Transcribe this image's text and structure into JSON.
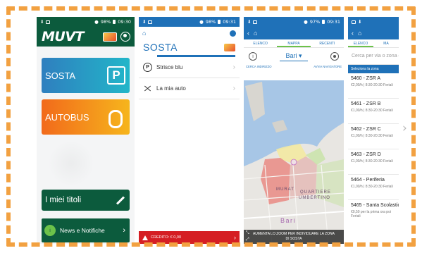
{
  "status": {
    "phone1_time": "09:30",
    "phone1_battery": "98%",
    "phone2_time": "09:31",
    "phone2_battery": "98%",
    "phone3_time": "09:31",
    "phone3_battery": "97%"
  },
  "home": {
    "logo": "MUVT",
    "sosta_label": "SOSTA",
    "sosta_icon_glyph": "P",
    "autobus_label": "AUTOBUS",
    "titoli_label": "I miei titoli",
    "news_label": "News e Notifiche",
    "news_icon_glyph": "i"
  },
  "sosta": {
    "title": "SOSTA",
    "items": [
      {
        "label": "Strisce blu",
        "icon": "parking-circle-icon",
        "icon_glyph": "P"
      },
      {
        "label": "La mia auto",
        "icon": "car-icon"
      }
    ],
    "credit_label": "CREDITO: € 0,00"
  },
  "map_screen": {
    "tabs": [
      "ELENCO",
      "MAPPA",
      "RECENTI"
    ],
    "active_tab": "MAPPA",
    "city": "Bari",
    "city_caret": "▾",
    "info_glyph": "i",
    "link_left": "Cerca indirizzo",
    "link_right": "Avvia navigatore",
    "map_labels": {
      "murat": "MURAT",
      "quartiere": "QUARTIERE",
      "umbertino": "UMBERTINO",
      "city_map": "Bari"
    },
    "caption": "AUMENTA LO ZOOM PER INDIVIDUARE LA ZONA DI SOSTA",
    "caption_icons": [
      "expand-icon",
      "collapse-icon"
    ]
  },
  "zones_screen": {
    "tabs": [
      "ELENCO",
      "MA"
    ],
    "search_placeholder": "Cerca per via o zona di",
    "header": "Seleziona la zona",
    "zones": [
      {
        "name": "5460 - ZSR A",
        "price": "€2,00/h | 8:30-20:30 Feriali"
      },
      {
        "name": "5461 - ZSR B",
        "price": "€1,00/h | 8:30-20:30 Feriali"
      },
      {
        "name": "5462 - ZSR C",
        "price": "€1,00/h | 8:30-20:30 Feriali"
      },
      {
        "name": "5463 - ZSR D",
        "price": "€1,00/h | 8:30-20:30 Feriali"
      },
      {
        "name": "5464 - Periferia",
        "price": "€1,00/h | 8:30-20:30 Feriali"
      },
      {
        "name": "5465 - Santa Scolastica",
        "price": "€0,50 per la prima ora poi",
        "price2": "Feriali"
      }
    ]
  },
  "navigation": {
    "next_glyph": "›"
  },
  "colors": {
    "muvt_green": "#0c5b3d",
    "app_blue": "#1f71b8",
    "credit_red": "#d51e23",
    "frame_orange": "#f2a141"
  }
}
